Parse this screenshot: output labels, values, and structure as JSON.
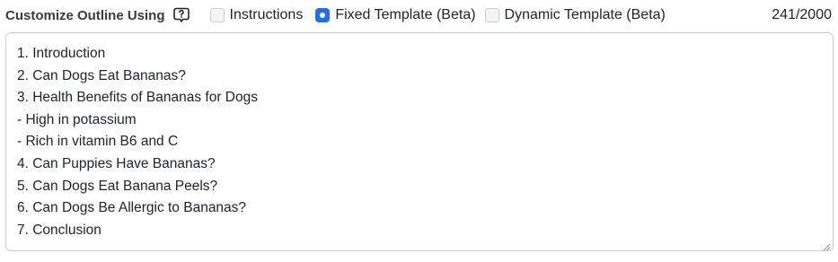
{
  "header": {
    "title": "Customize Outline Using",
    "help_icon": "help-question-icon",
    "options": [
      {
        "label": "Instructions",
        "selected": false
      },
      {
        "label": "Fixed Template (Beta)",
        "selected": true
      },
      {
        "label": "Dynamic Template (Beta)",
        "selected": false
      }
    ],
    "char_counter": "241/2000"
  },
  "colors": {
    "accent": "#1d6ef0",
    "border": "#c6cbd1"
  },
  "outline": {
    "lines": [
      "1. Introduction",
      "2. Can Dogs Eat Bananas?",
      "3. Health Benefits of Bananas for Dogs",
      "- High in potassium",
      "- Rich in vitamin B6 and C",
      "4. Can Puppies Have Bananas?",
      "5. Can Dogs Eat Banana Peels?",
      "6. Can Dogs Be Allergic to Bananas?",
      "7. Conclusion"
    ]
  }
}
